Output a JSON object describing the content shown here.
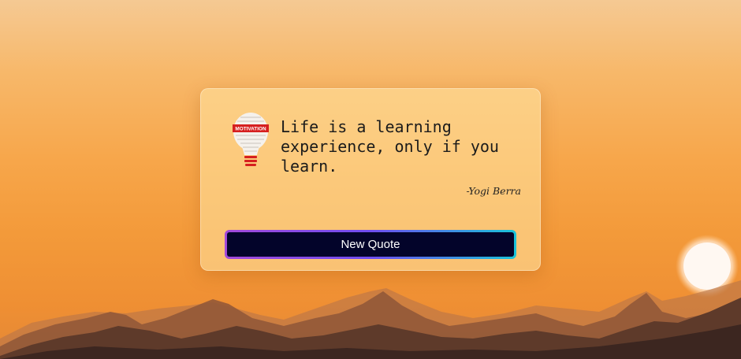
{
  "quote": {
    "text": "Life is a learning experience, only if you learn.",
    "author": "-Yogi Berra",
    "icon": "motivation-lightbulb-icon",
    "icon_label": "MOTIVATION"
  },
  "button": {
    "label": "New Quote"
  },
  "background": {
    "scene": "sunset-mountains",
    "sky_top_color": "#f5c993",
    "sky_bottom_color": "#e48836",
    "sun_color": "#fff6ee"
  },
  "button_colors": {
    "fill": "#03042a",
    "border_start": "#a34ad9",
    "border_end": "#19c4d9"
  }
}
